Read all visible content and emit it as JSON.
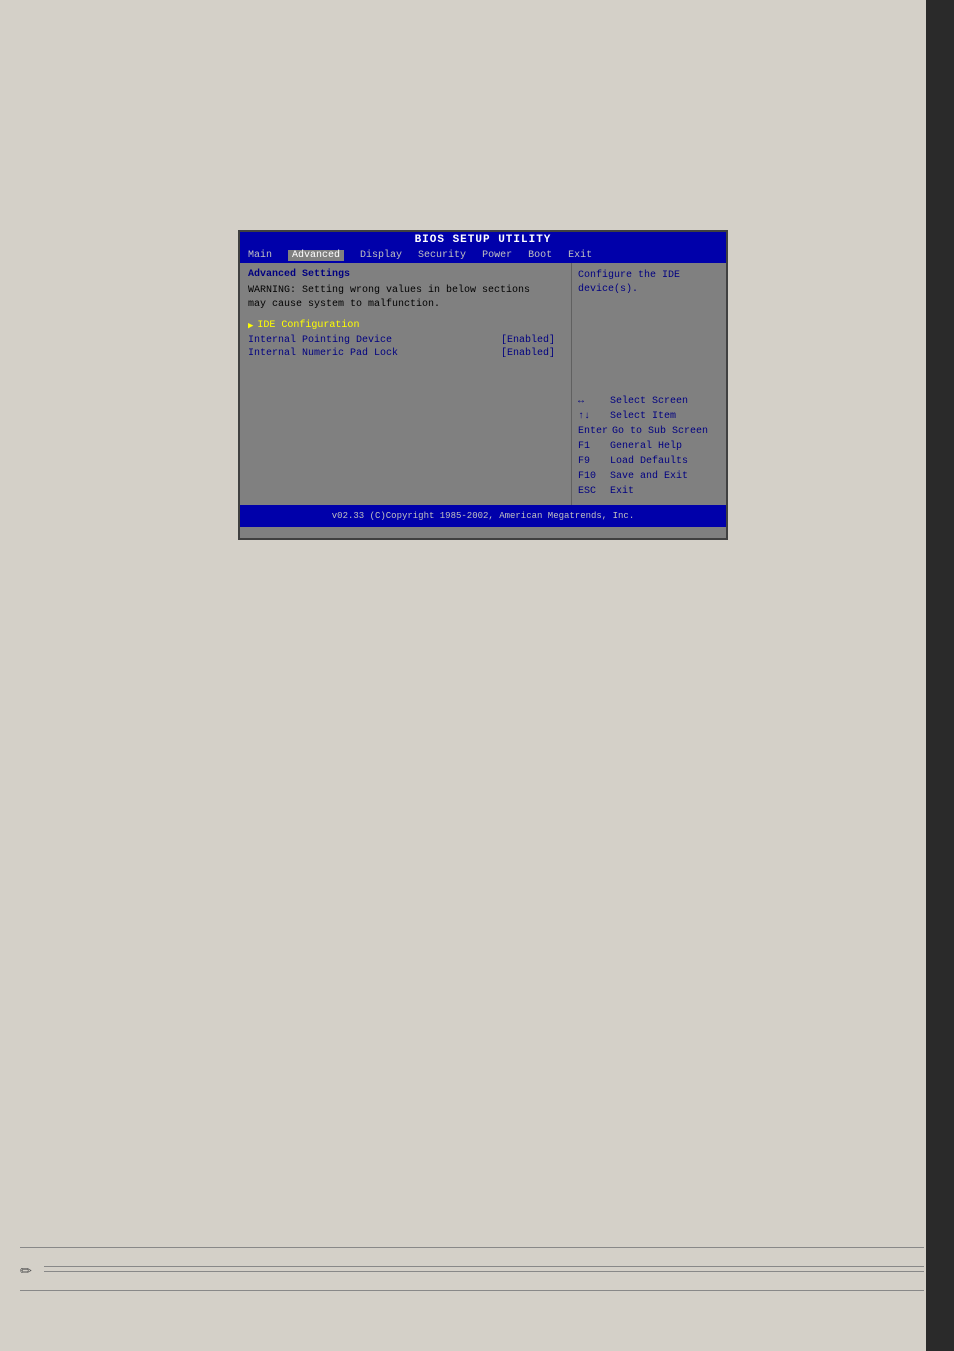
{
  "bios": {
    "title": "BIOS SETUP UTILITY",
    "menu": {
      "items": [
        {
          "label": "Main",
          "active": false
        },
        {
          "label": "Advanced",
          "active": true
        },
        {
          "label": "Display",
          "active": false
        },
        {
          "label": "Security",
          "active": false
        },
        {
          "label": "Power",
          "active": false
        },
        {
          "label": "Boot",
          "active": false
        },
        {
          "label": "Exit",
          "active": false
        }
      ]
    },
    "left_panel": {
      "section_title": "Advanced Settings",
      "warning_line1": "WARNING: Setting wrong values in below sections",
      "warning_line2": "         may cause system to malfunction.",
      "ide_config_label": "IDE Configuration",
      "rows": [
        {
          "label": "Internal Pointing Device",
          "value": "[Enabled]"
        },
        {
          "label": "Internal Numeric Pad Lock",
          "value": "[Enabled]"
        }
      ]
    },
    "right_panel": {
      "help_text": "Configure the IDE device(s).",
      "keys": [
        {
          "key": "↔",
          "desc": "Select Screen"
        },
        {
          "key": "↑↓",
          "desc": "Select Item"
        },
        {
          "key": "Enter",
          "desc": "Go to Sub Screen"
        },
        {
          "key": "F1",
          "desc": "General Help"
        },
        {
          "key": "F9",
          "desc": "Load Defaults"
        },
        {
          "key": "F10",
          "desc": "Save and Exit"
        },
        {
          "key": "ESC",
          "desc": "Exit"
        }
      ]
    },
    "footer": "v02.33 (C)Copyright 1985-2002, American Megatrends, Inc."
  }
}
